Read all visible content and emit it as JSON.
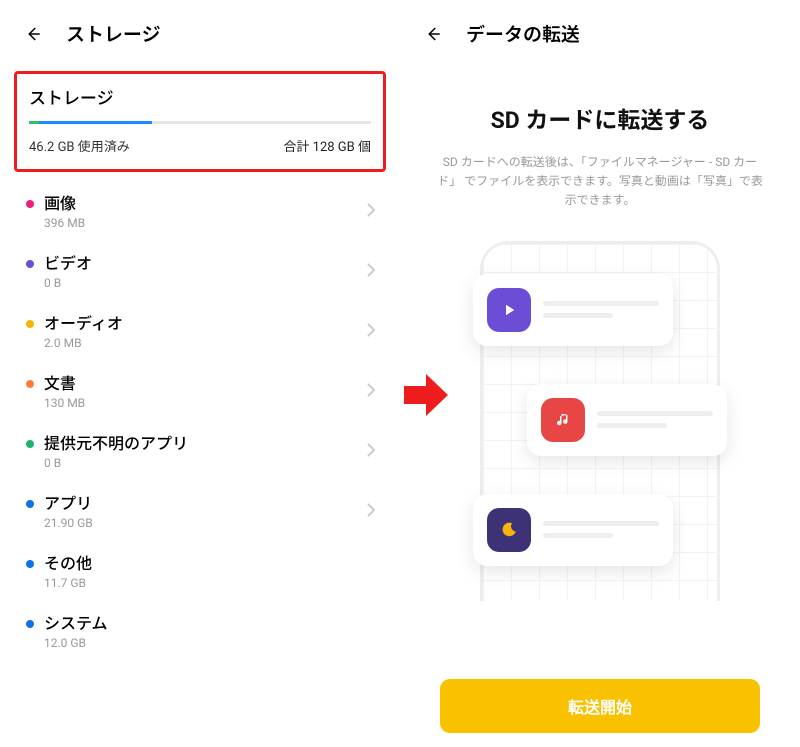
{
  "left": {
    "headerTitle": "ストレージ",
    "summaryTitle": "ストレージ",
    "usedText": "46.2 GB 使用済み",
    "totalText": "合計 128 GB 個",
    "progress": [
      {
        "color": "#2cc36b",
        "width": "3%"
      },
      {
        "color": "#1e88ff",
        "width": "33%"
      }
    ],
    "categories": [
      {
        "id": "images",
        "label": "画像",
        "size": "396 MB",
        "dot": "#ee1c7a",
        "chevron": true
      },
      {
        "id": "video",
        "label": "ビデオ",
        "size": "0 B",
        "dot": "#6b4dd6",
        "chevron": true
      },
      {
        "id": "audio",
        "label": "オーディオ",
        "size": "2.0 MB",
        "dot": "#f6b40a",
        "chevron": true
      },
      {
        "id": "docs",
        "label": "文書",
        "size": "130 MB",
        "dot": "#ff7a3c",
        "chevron": true
      },
      {
        "id": "unknown",
        "label": "提供元不明のアプリ",
        "size": "0 B",
        "dot": "#1db36a",
        "chevron": true
      },
      {
        "id": "apps",
        "label": "アプリ",
        "size": "21.90  GB",
        "dot": "#1070e8",
        "chevron": true
      },
      {
        "id": "other",
        "label": "その他",
        "size": "11.7 GB",
        "dot": "#1070e8",
        "chevron": false
      },
      {
        "id": "system",
        "label": "システム",
        "size": "12.0 GB",
        "dot": "#1070e8",
        "chevron": false
      }
    ]
  },
  "right": {
    "headerTitle": "データの転送",
    "title": "SD カードに転送する",
    "desc": "SD カードへの転送後は、「ファイルマネージャー - SD カード」 でファイルを表示できます。写真と動画は「写真」で表示できます。",
    "button": "転送開始"
  }
}
